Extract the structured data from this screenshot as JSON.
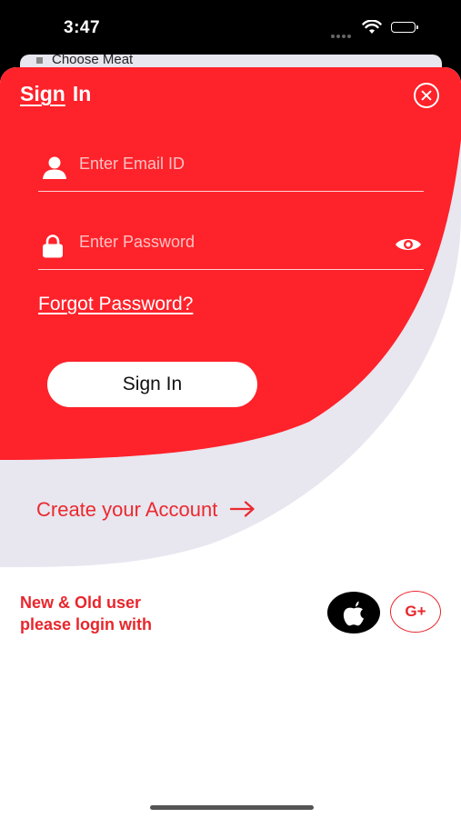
{
  "status_bar": {
    "time": "3:47"
  },
  "background_screen": {
    "label": "Choose Meat"
  },
  "header": {
    "sign": "Sign",
    "in": "In"
  },
  "form": {
    "email": {
      "placeholder": "Enter Email ID",
      "value": ""
    },
    "password": {
      "placeholder": "Enter Password",
      "value": ""
    },
    "forgot_label": "Forgot Password?",
    "submit_label": "Sign In"
  },
  "create_account": {
    "label": "Create your Account"
  },
  "social": {
    "line1": "New & Old user",
    "line2": "please login with",
    "google_label": "G+"
  },
  "colors": {
    "brand_red": "#fe222a",
    "accent_red": "#ea2a2f",
    "lavender": "#e8e6ef"
  },
  "icons": [
    "user-icon",
    "lock-icon",
    "eye-icon",
    "close-icon",
    "arrow-right-icon",
    "apple-icon",
    "google-plus-icon"
  ]
}
